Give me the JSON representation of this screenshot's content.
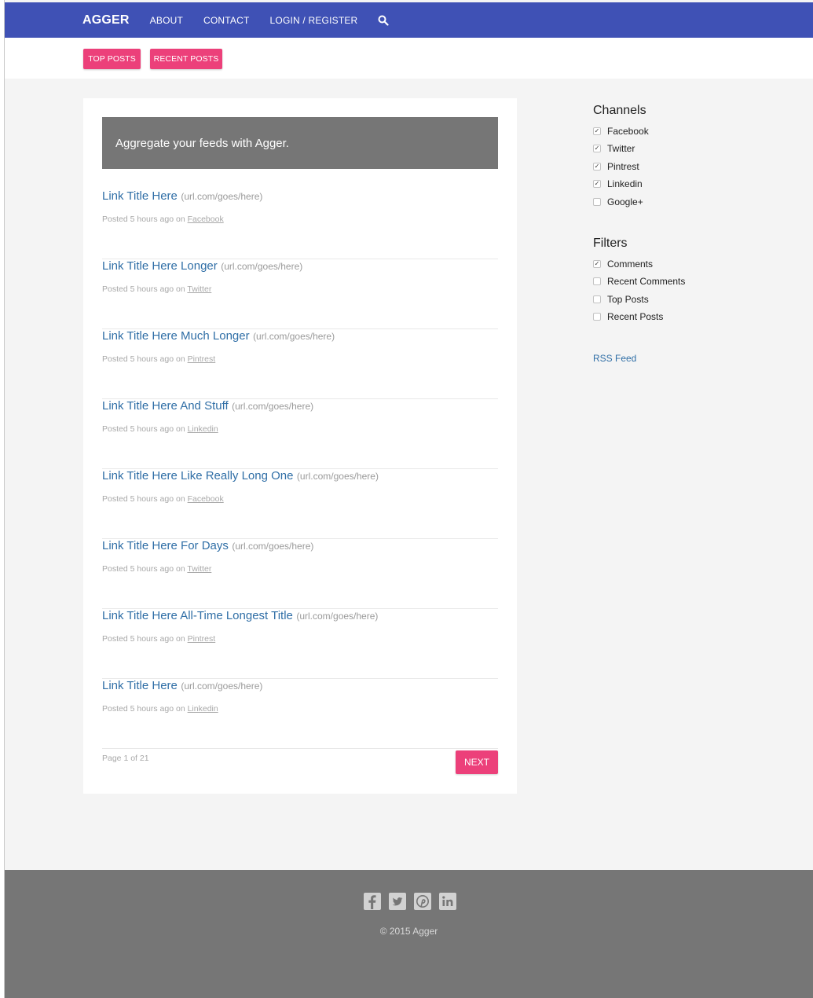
{
  "nav": {
    "brand": "AGGER",
    "links": [
      "ABOUT",
      "CONTACT",
      "LOGIN / REGISTER"
    ],
    "search_icon": "search-icon"
  },
  "subnav": {
    "top_posts": "TOP POSTS",
    "recent_posts": "RECENT POSTS"
  },
  "banner": "Aggregate your feeds with Agger.",
  "posts": [
    {
      "title": "Link Title Here",
      "url": "(url.com/goes/here)",
      "meta": "Posted 5 hours ago on ",
      "channel": "Facebook"
    },
    {
      "title": "Link Title Here Longer",
      "url": "(url.com/goes/here)",
      "meta": "Posted 5 hours ago on ",
      "channel": "Twitter"
    },
    {
      "title": "Link Title Here Much Longer",
      "url": "(url.com/goes/here)",
      "meta": "Posted 5 hours ago on ",
      "channel": "Pintrest"
    },
    {
      "title": "Link Title Here And Stuff",
      "url": "(url.com/goes/here)",
      "meta": "Posted 5 hours ago on ",
      "channel": "Linkedin"
    },
    {
      "title": "Link Title Here Like Really Long One",
      "url": "(url.com/goes/here)",
      "meta": "Posted 5 hours ago on ",
      "channel": "Facebook"
    },
    {
      "title": "Link Title Here For Days",
      "url": "(url.com/goes/here)",
      "meta": "Posted 5 hours ago on ",
      "channel": "Twitter"
    },
    {
      "title": "Link Title Here All-Time Longest Title",
      "url": "(url.com/goes/here)",
      "meta": "Posted 5 hours ago on ",
      "channel": "Pintrest"
    },
    {
      "title": "Link Title Here",
      "url": "(url.com/goes/here)",
      "meta": "Posted 5 hours ago on ",
      "channel": "Linkedin"
    }
  ],
  "pagination": {
    "page_info": "Page 1 of 21",
    "next": "NEXT"
  },
  "sidebar": {
    "channels_heading": "Channels",
    "channels": [
      {
        "label": "Facebook",
        "checked": true
      },
      {
        "label": "Twitter",
        "checked": true
      },
      {
        "label": "Pintrest",
        "checked": true
      },
      {
        "label": "Linkedin",
        "checked": true
      },
      {
        "label": "Google+",
        "checked": false
      }
    ],
    "filters_heading": "Filters",
    "filters": [
      {
        "label": "Comments",
        "checked": true
      },
      {
        "label": "Recent Comments",
        "checked": false
      },
      {
        "label": "Top Posts",
        "checked": false
      },
      {
        "label": "Recent Posts",
        "checked": false
      }
    ],
    "rss": "RSS Feed"
  },
  "footer": {
    "social_icons": [
      "facebook-icon",
      "twitter-icon",
      "pinterest-icon",
      "linkedin-icon"
    ],
    "copyright": "© 2015 Agger"
  },
  "colors": {
    "primary": "#3f51b5",
    "accent": "#ec407a",
    "link": "#2f6ea6",
    "banner": "#767676",
    "footer": "#767676"
  }
}
